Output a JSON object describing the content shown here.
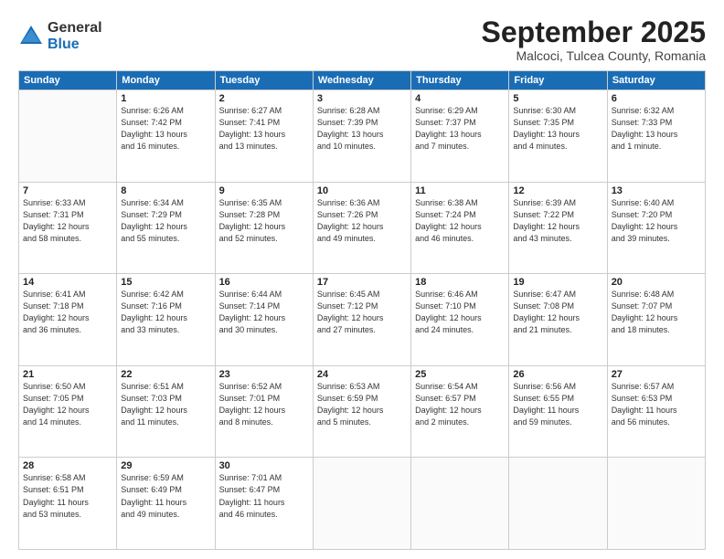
{
  "logo": {
    "general": "General",
    "blue": "Blue"
  },
  "header": {
    "month": "September 2025",
    "location": "Malcoci, Tulcea County, Romania"
  },
  "weekdays": [
    "Sunday",
    "Monday",
    "Tuesday",
    "Wednesday",
    "Thursday",
    "Friday",
    "Saturday"
  ],
  "weeks": [
    [
      {
        "day": "",
        "info": ""
      },
      {
        "day": "1",
        "info": "Sunrise: 6:26 AM\nSunset: 7:42 PM\nDaylight: 13 hours\nand 16 minutes."
      },
      {
        "day": "2",
        "info": "Sunrise: 6:27 AM\nSunset: 7:41 PM\nDaylight: 13 hours\nand 13 minutes."
      },
      {
        "day": "3",
        "info": "Sunrise: 6:28 AM\nSunset: 7:39 PM\nDaylight: 13 hours\nand 10 minutes."
      },
      {
        "day": "4",
        "info": "Sunrise: 6:29 AM\nSunset: 7:37 PM\nDaylight: 13 hours\nand 7 minutes."
      },
      {
        "day": "5",
        "info": "Sunrise: 6:30 AM\nSunset: 7:35 PM\nDaylight: 13 hours\nand 4 minutes."
      },
      {
        "day": "6",
        "info": "Sunrise: 6:32 AM\nSunset: 7:33 PM\nDaylight: 13 hours\nand 1 minute."
      }
    ],
    [
      {
        "day": "7",
        "info": "Sunrise: 6:33 AM\nSunset: 7:31 PM\nDaylight: 12 hours\nand 58 minutes."
      },
      {
        "day": "8",
        "info": "Sunrise: 6:34 AM\nSunset: 7:29 PM\nDaylight: 12 hours\nand 55 minutes."
      },
      {
        "day": "9",
        "info": "Sunrise: 6:35 AM\nSunset: 7:28 PM\nDaylight: 12 hours\nand 52 minutes."
      },
      {
        "day": "10",
        "info": "Sunrise: 6:36 AM\nSunset: 7:26 PM\nDaylight: 12 hours\nand 49 minutes."
      },
      {
        "day": "11",
        "info": "Sunrise: 6:38 AM\nSunset: 7:24 PM\nDaylight: 12 hours\nand 46 minutes."
      },
      {
        "day": "12",
        "info": "Sunrise: 6:39 AM\nSunset: 7:22 PM\nDaylight: 12 hours\nand 43 minutes."
      },
      {
        "day": "13",
        "info": "Sunrise: 6:40 AM\nSunset: 7:20 PM\nDaylight: 12 hours\nand 39 minutes."
      }
    ],
    [
      {
        "day": "14",
        "info": "Sunrise: 6:41 AM\nSunset: 7:18 PM\nDaylight: 12 hours\nand 36 minutes."
      },
      {
        "day": "15",
        "info": "Sunrise: 6:42 AM\nSunset: 7:16 PM\nDaylight: 12 hours\nand 33 minutes."
      },
      {
        "day": "16",
        "info": "Sunrise: 6:44 AM\nSunset: 7:14 PM\nDaylight: 12 hours\nand 30 minutes."
      },
      {
        "day": "17",
        "info": "Sunrise: 6:45 AM\nSunset: 7:12 PM\nDaylight: 12 hours\nand 27 minutes."
      },
      {
        "day": "18",
        "info": "Sunrise: 6:46 AM\nSunset: 7:10 PM\nDaylight: 12 hours\nand 24 minutes."
      },
      {
        "day": "19",
        "info": "Sunrise: 6:47 AM\nSunset: 7:08 PM\nDaylight: 12 hours\nand 21 minutes."
      },
      {
        "day": "20",
        "info": "Sunrise: 6:48 AM\nSunset: 7:07 PM\nDaylight: 12 hours\nand 18 minutes."
      }
    ],
    [
      {
        "day": "21",
        "info": "Sunrise: 6:50 AM\nSunset: 7:05 PM\nDaylight: 12 hours\nand 14 minutes."
      },
      {
        "day": "22",
        "info": "Sunrise: 6:51 AM\nSunset: 7:03 PM\nDaylight: 12 hours\nand 11 minutes."
      },
      {
        "day": "23",
        "info": "Sunrise: 6:52 AM\nSunset: 7:01 PM\nDaylight: 12 hours\nand 8 minutes."
      },
      {
        "day": "24",
        "info": "Sunrise: 6:53 AM\nSunset: 6:59 PM\nDaylight: 12 hours\nand 5 minutes."
      },
      {
        "day": "25",
        "info": "Sunrise: 6:54 AM\nSunset: 6:57 PM\nDaylight: 12 hours\nand 2 minutes."
      },
      {
        "day": "26",
        "info": "Sunrise: 6:56 AM\nSunset: 6:55 PM\nDaylight: 11 hours\nand 59 minutes."
      },
      {
        "day": "27",
        "info": "Sunrise: 6:57 AM\nSunset: 6:53 PM\nDaylight: 11 hours\nand 56 minutes."
      }
    ],
    [
      {
        "day": "28",
        "info": "Sunrise: 6:58 AM\nSunset: 6:51 PM\nDaylight: 11 hours\nand 53 minutes."
      },
      {
        "day": "29",
        "info": "Sunrise: 6:59 AM\nSunset: 6:49 PM\nDaylight: 11 hours\nand 49 minutes."
      },
      {
        "day": "30",
        "info": "Sunrise: 7:01 AM\nSunset: 6:47 PM\nDaylight: 11 hours\nand 46 minutes."
      },
      {
        "day": "",
        "info": ""
      },
      {
        "day": "",
        "info": ""
      },
      {
        "day": "",
        "info": ""
      },
      {
        "day": "",
        "info": ""
      }
    ]
  ]
}
